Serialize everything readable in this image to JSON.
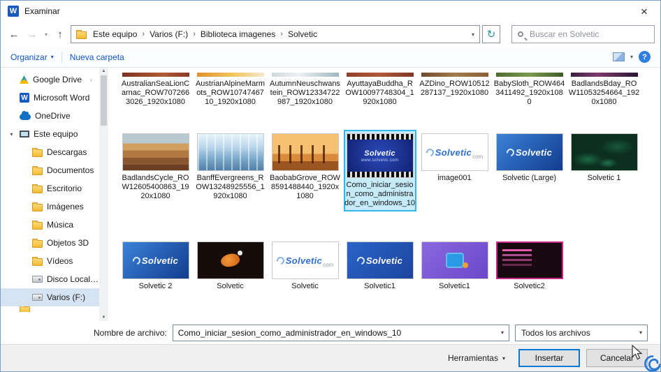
{
  "window": {
    "title": "Examinar"
  },
  "nav": {
    "breadcrumb": [
      "Este equipo",
      "Varios (F:)",
      "Biblioteca imagenes",
      "Solvetic"
    ],
    "search_placeholder": "Buscar en Solvetic"
  },
  "toolbar": {
    "organize": "Organizar",
    "new_folder": "Nueva carpeta"
  },
  "sidebar": {
    "items": [
      {
        "label": "Google Drive",
        "icon": "gdrive",
        "expand_after": true
      },
      {
        "label": "Microsoft Word",
        "icon": "word"
      },
      {
        "label": "OneDrive",
        "icon": "cloud"
      },
      {
        "label": "Este equipo",
        "icon": "computer",
        "expanded": true
      },
      {
        "label": "Descargas",
        "icon": "folder",
        "indent": 1
      },
      {
        "label": "Documentos",
        "icon": "folder",
        "indent": 1
      },
      {
        "label": "Escritorio",
        "icon": "folder",
        "indent": 1
      },
      {
        "label": "Imágenes",
        "icon": "folder",
        "indent": 1
      },
      {
        "label": "Música",
        "icon": "folder",
        "indent": 1
      },
      {
        "label": "Objetos 3D",
        "icon": "folder",
        "indent": 1
      },
      {
        "label": "Vídeos",
        "icon": "folder",
        "indent": 1
      },
      {
        "label": "Disco Local (C:)",
        "icon": "disk",
        "indent": 1
      },
      {
        "label": "Varios (F:)",
        "icon": "disk",
        "indent": 1,
        "selected": true
      }
    ]
  },
  "brand": {
    "name": "Solvetic",
    "tld": "com",
    "url": "www.solvetic.com"
  },
  "files": {
    "rows": [
      {
        "cut": true,
        "items": [
          {
            "name": "AustralianSeaLionCarnac_ROW7072663026_1920x1080",
            "thumb": "strip-sealion"
          },
          {
            "name": "AustrianAlpineMarmots_ROW1074746710_1920x1080",
            "thumb": "strip-marmots"
          },
          {
            "name": "AutumnNeuschwanstein_ROW12334722987_1920x1080",
            "thumb": "strip-neuschwanstein"
          },
          {
            "name": "AyuttayaBuddha_ROW10097748304_1920x1080",
            "thumb": "strip-buddha"
          },
          {
            "name": "AZDino_ROW10512287137_1920x1080",
            "thumb": "strip-azdino"
          },
          {
            "name": "BabySloth_ROW4643411492_1920x1080",
            "thumb": "strip-sloth"
          },
          {
            "name": "BadlandsBday_ROW11053254664_1920x1080",
            "thumb": "strip-bday"
          }
        ]
      },
      {
        "items": [
          {
            "name": "BadlandsCycle_ROW12605400863_1920x1080",
            "thumb": "badlands"
          },
          {
            "name": "BanffEvergreens_ROW13248925556_1920x1080",
            "thumb": "banff"
          },
          {
            "name": "BaobabGrove_ROW8591488440_1920x1080",
            "thumb": "baobab"
          },
          {
            "name": "Como_iniciar_sesion_como_administrador_en_windows_10",
            "thumb": "filmstrip",
            "selected": true
          },
          {
            "name": "image001",
            "thumb": "logo-white"
          },
          {
            "name": "Solvetic (Large)",
            "thumb": "logo-blue"
          },
          {
            "name": "Solvetic 1",
            "thumb": "green-map"
          }
        ]
      },
      {
        "items": [
          {
            "name": "Solvetic 2",
            "thumb": "logo-blue"
          },
          {
            "name": "Solvetic",
            "thumb": "ibis"
          },
          {
            "name": "Solvetic",
            "thumb": "logo-white"
          },
          {
            "name": "Solvetic1",
            "thumb": "logo-blue2"
          },
          {
            "name": "Solvetic1",
            "thumb": "purple-icons"
          },
          {
            "name": "Solvetic2",
            "thumb": "terminal"
          }
        ]
      }
    ]
  },
  "footer": {
    "filename_label": "Nombre de archivo:",
    "filename_value": "Como_iniciar_sesion_como_administrador_en_windows_10",
    "filetype_value": "Todos los archivos",
    "tools_label": "Herramientas",
    "insert_label": "Insertar",
    "cancel_label": "Cancelar"
  },
  "colors": {
    "selection_fill": "#c6ebfa",
    "selection_border": "#35b6e8",
    "accent": "#0078d7",
    "link_blue": "#1255c4"
  }
}
